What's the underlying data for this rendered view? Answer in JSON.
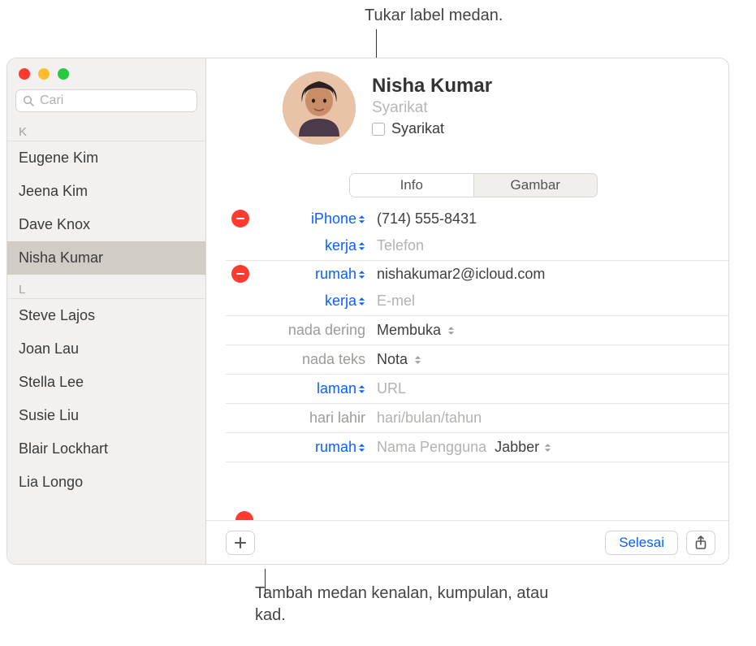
{
  "callouts": {
    "top": "Tukar label medan.",
    "bottom": "Tambah medan kenalan, kumpulan, atau kad."
  },
  "search": {
    "placeholder": "Cari"
  },
  "sections": {
    "K": {
      "letter": "K",
      "items": [
        "Eugene Kim",
        "Jeena Kim",
        "Dave Knox",
        "Nisha Kumar"
      ]
    },
    "L": {
      "letter": "L",
      "items": [
        "Steve Lajos",
        "Joan Lau",
        "Stella Lee",
        "Susie Liu",
        "Blair Lockhart",
        "Lia Longo"
      ]
    }
  },
  "selected": "Nisha Kumar",
  "contact": {
    "name": "Nisha  Kumar",
    "company_placeholder": "Syarikat",
    "company_checkbox_label": "Syarikat"
  },
  "tabs": {
    "info": "Info",
    "picture": "Gambar"
  },
  "fields": {
    "phone_label": "iPhone",
    "phone_value": "(714) 555-8431",
    "phone2_label": "kerja",
    "phone2_placeholder": "Telefon",
    "email_label": "rumah",
    "email_value": "nishakumar2@icloud.com",
    "email2_label": "kerja",
    "email2_placeholder": "E-mel",
    "ringtone_label": "nada dering",
    "ringtone_value": "Membuka",
    "texttone_label": "nada teks",
    "texttone_value": "Nota",
    "url_label": "laman",
    "url_placeholder": "URL",
    "bday_label": "hari lahir",
    "bday_placeholder": "hari/bulan/tahun",
    "im_label": "rumah",
    "im_placeholder": "Nama Pengguna",
    "im_service": "Jabber"
  },
  "buttons": {
    "done": "Selesai"
  }
}
